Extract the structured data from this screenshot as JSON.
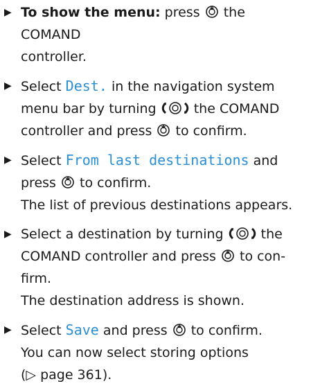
{
  "steps": [
    {
      "lead_bold": "To show the menu:",
      "t1": "press",
      "t2": "the COMAND",
      "t3": "controller."
    },
    {
      "t1": "Select",
      "menu": "Dest.",
      "t2": "in the navigation system",
      "t3": "menu bar by turning",
      "t4": "the COMAND",
      "t5": "controller and press",
      "t6": "to confirm."
    },
    {
      "t1": "Select",
      "menu": "From last destinations",
      "t2": "and",
      "t3": "press",
      "t4": "to confirm.",
      "result": "The list of previous destinations appears."
    },
    {
      "t1": "Select a destination by turning",
      "t2": "the",
      "t3": "COMAND controller and press",
      "t4": "to con-",
      "t5": "firm.",
      "result": "The destination address is shown."
    },
    {
      "t1": "Select",
      "menu": "Save",
      "t2": "and press",
      "t3": "to confirm.",
      "result": "You can now select storing options",
      "ref": "(▷ page 361)."
    }
  ],
  "colors": {
    "menu": "#2a8fd6",
    "text": "#1a1a1a"
  },
  "icons": {
    "arrow": "▶",
    "press": "controller-press-icon",
    "turn": "controller-turn-icon"
  }
}
